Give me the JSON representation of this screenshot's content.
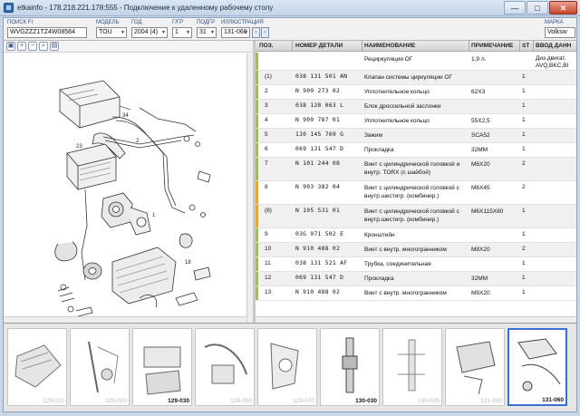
{
  "window": {
    "title": "etkainfo - 178.218.221.178:555 - Подключение к удаленному рабочему столу",
    "minimize": "—",
    "maximize": "□",
    "close": "✕"
  },
  "filters": {
    "search": {
      "label": "ПОИСК FI",
      "value": "WVGZZZ1TZ4W08584"
    },
    "model": {
      "label": "МОДЕЛЬ",
      "value": "TOU"
    },
    "year": {
      "label": "ГОД",
      "value": "2004 (4)"
    },
    "group": {
      "label": "Г/ГР",
      "value": "1"
    },
    "subgroup": {
      "label": "ПОДГР",
      "value": "31"
    },
    "illustration": {
      "label": "ИЛЛЮСТРАЦИЯ",
      "value": "131-060"
    },
    "brand": {
      "label": "МАРКА",
      "value": "Volksw"
    }
  },
  "toolbar": {
    "icons": [
      "fit-icon",
      "zoom-in-icon",
      "zoom-out-icon",
      "zoom-region-icon",
      "print-icon"
    ]
  },
  "table": {
    "headers": {
      "pos": "ПОЗ.",
      "number": "НОМЕР ДЕТАЛИ",
      "name": "НАИМЕНОВАНИЕ",
      "note": "ПРИМЕЧАНИЕ",
      "st": "ST",
      "extra": "ВВОД ДАНН"
    },
    "rows": [
      {
        "pos": "",
        "number": "",
        "name": "Рециркуляция ОГ",
        "note": "1,9 л.",
        "st": "",
        "extra": "Диз.двигат.\nAVQ,BKC,BI",
        "mark": "#9dbb6a"
      },
      {
        "pos": "(1)",
        "number": "038 131 501 AN",
        "name": "Клапан системы циркуляции ОГ",
        "note": "",
        "st": "1",
        "extra": "",
        "mark": "#9dbb6a"
      },
      {
        "pos": "2",
        "number": "N  909 273 02",
        "name": "Уплотнительное кольцо",
        "note": "62X3",
        "st": "1",
        "extra": "",
        "mark": "#9dbb6a"
      },
      {
        "pos": "3",
        "number": "038 128 063 L",
        "name": "Блок дроссельной заслонки",
        "note": "",
        "st": "1",
        "extra": "",
        "mark": "#9dbb6a"
      },
      {
        "pos": "4",
        "number": "N  909 787 01",
        "name": "Уплотнительное кольцо",
        "note": "55X2,5",
        "st": "1",
        "extra": "",
        "mark": "#9dbb6a"
      },
      {
        "pos": "5",
        "number": "1J0 145 769 G",
        "name": "Зажим",
        "note": "SCA52",
        "st": "1",
        "extra": "",
        "mark": "#9dbb6a"
      },
      {
        "pos": "6",
        "number": "069 131 547 D",
        "name": "Прокладка",
        "note": "32MM",
        "st": "1",
        "extra": "",
        "mark": "#9dbb6a"
      },
      {
        "pos": "7",
        "number": "N  101 244 08",
        "name": "Винт с цилиндрической головкой и внутр. TORX (с шайбой)",
        "note": "M6X20",
        "st": "2",
        "extra": "",
        "mark": "#9dbb6a"
      },
      {
        "pos": "8",
        "number": "N  903 382 04",
        "name": "Винт с цилиндрической головкой с внутр.шестигр. (комбинир.)",
        "note": "M6X45",
        "st": "2",
        "extra": "",
        "mark": "#e8a33c"
      },
      {
        "pos": "(8)",
        "number": "N  105 531 01",
        "name": "Винт с цилиндрической головкой с внутр.шестигр. (комбинир.)",
        "note": "M6X115X80",
        "st": "1",
        "extra": "",
        "mark": "#e8a33c"
      },
      {
        "pos": "9",
        "number": "03G 971 502 E",
        "name": "Кронштейн",
        "note": "",
        "st": "1",
        "extra": "",
        "mark": "#9dbb6a"
      },
      {
        "pos": "10",
        "number": "N  910 488 02",
        "name": "Винт с внутр. многогранником",
        "note": "M8X20",
        "st": "2",
        "extra": "",
        "mark": "#9dbb6a"
      },
      {
        "pos": "11",
        "number": "038 131 521 AF",
        "name": "Трубка, соединительная",
        "note": "",
        "st": "1",
        "extra": "",
        "mark": "#9dbb6a"
      },
      {
        "pos": "12",
        "number": "069 131 547 D",
        "name": "Прокладка",
        "note": "32MM",
        "st": "1",
        "extra": "",
        "mark": "#9dbb6a"
      },
      {
        "pos": "13",
        "number": "N  910 488 02",
        "name": "Винт с внутр. многогранником",
        "note": "M8X20",
        "st": "1",
        "extra": "",
        "mark": "#9dbb6a"
      }
    ]
  },
  "illustration_callouts": [
    "34",
    "23",
    "2",
    "1",
    "18"
  ],
  "thumbnails": [
    {
      "label": "129-010",
      "selected": false,
      "bold": false
    },
    {
      "label": "129-020",
      "selected": false,
      "bold": false
    },
    {
      "label": "129-030",
      "selected": false,
      "bold": true
    },
    {
      "label": "129-050",
      "selected": false,
      "bold": false
    },
    {
      "label": "129-070",
      "selected": false,
      "bold": false
    },
    {
      "label": "130-030",
      "selected": false,
      "bold": true
    },
    {
      "label": "130-035",
      "selected": false,
      "bold": false
    },
    {
      "label": "131-000",
      "selected": false,
      "bold": false
    },
    {
      "label": "131-060",
      "selected": true,
      "bold": true
    }
  ]
}
